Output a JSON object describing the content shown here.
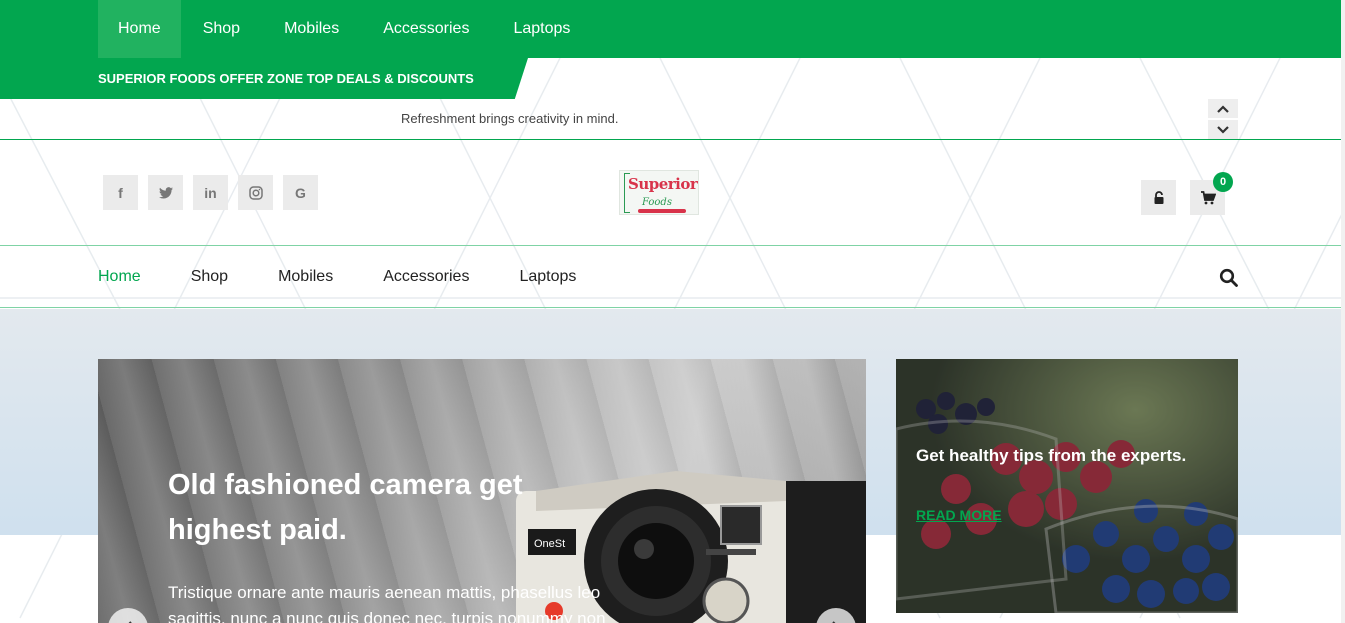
{
  "top_nav": {
    "items": [
      {
        "label": "Home",
        "active": true
      },
      {
        "label": "Shop"
      },
      {
        "label": "Mobiles"
      },
      {
        "label": "Accessories"
      },
      {
        "label": "Laptops"
      }
    ]
  },
  "ticker": {
    "label": "SUPERIOR FOODS OFFER ZONE TOP DEALS & DISCOUNTS",
    "text": "Refreshment brings creativity in mind.",
    "up_icon": "chevron-up-icon",
    "down_icon": "chevron-down-icon"
  },
  "header": {
    "social": [
      {
        "icon": "facebook-icon",
        "glyph": "f"
      },
      {
        "icon": "twitter-icon",
        "glyph": "t"
      },
      {
        "icon": "linkedin-icon",
        "glyph": "in"
      },
      {
        "icon": "instagram-icon",
        "glyph": "◎"
      },
      {
        "icon": "google-icon",
        "glyph": "G"
      }
    ],
    "logo": {
      "text": "Superior",
      "sub": "Foods"
    },
    "login_icon": "unlock-icon",
    "cart_icon": "cart-icon",
    "cart_count": "0"
  },
  "main_nav": {
    "items": [
      {
        "label": "Home",
        "active": true
      },
      {
        "label": "Shop"
      },
      {
        "label": "Mobiles"
      },
      {
        "label": "Accessories"
      },
      {
        "label": "Laptops"
      }
    ],
    "search_icon": "search-icon"
  },
  "hero": {
    "title": "Old fashioned camera get highest paid.",
    "text": "Tristique ornare ante mauris aenean mattis, phasellus leo sagittis, nunc a nunc quis donec nec, turpis nonummy non",
    "camera_brand": "OneSt"
  },
  "side_card": {
    "title": "Get healthy tips from the experts.",
    "link": "READ MORE"
  },
  "colors": {
    "brand_green": "#02a64f",
    "nav_active": "#21b260"
  }
}
